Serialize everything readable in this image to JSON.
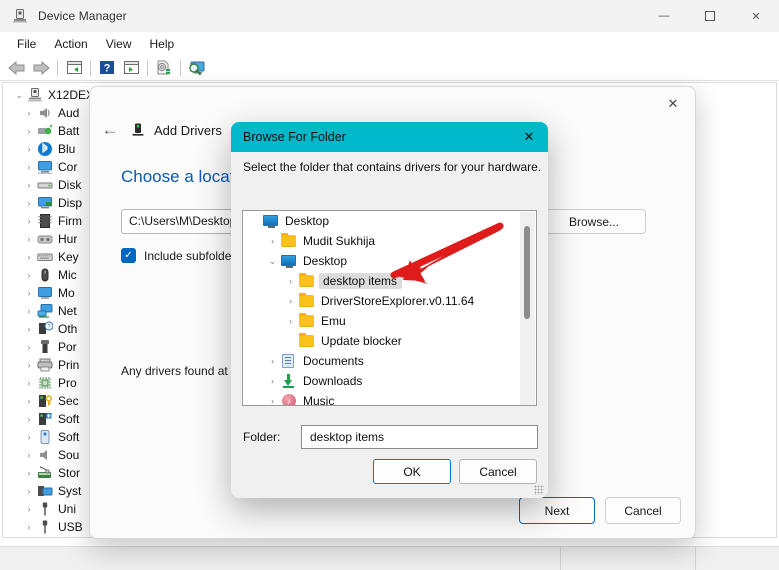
{
  "window": {
    "title": "Device Manager",
    "icon": "device-manager-icon",
    "controls": {
      "minimize": "—",
      "maximize": "☐",
      "close": "✕"
    }
  },
  "menubar": {
    "items": [
      "File",
      "Action",
      "View",
      "Help"
    ]
  },
  "toolbar": {
    "buttons": [
      "back-icon",
      "forward-icon",
      "show-hidden-devices-icon",
      "help-icon",
      "properties-icon",
      "update-driver-icon",
      "scan-hardware-icon"
    ]
  },
  "device_tree": {
    "root": {
      "label": "X12DEX",
      "expanded": true,
      "icon": "computer-icon"
    },
    "items": [
      {
        "label": "Aud",
        "icon": "audio-icon"
      },
      {
        "label": "Batt",
        "icon": "battery-icon"
      },
      {
        "label": "Blu",
        "icon": "bluetooth-icon"
      },
      {
        "label": "Cor",
        "icon": "computer-icon"
      },
      {
        "label": "Disk",
        "icon": "disk-drive-icon"
      },
      {
        "label": "Disp",
        "icon": "display-adapter-icon"
      },
      {
        "label": "Firm",
        "icon": "firmware-icon"
      },
      {
        "label": "Hur",
        "icon": "human-interface-icon"
      },
      {
        "label": "Key",
        "icon": "keyboard-icon"
      },
      {
        "label": "Mic",
        "icon": "mouse-icon"
      },
      {
        "label": "Mo",
        "icon": "monitor-icon"
      },
      {
        "label": "Net",
        "icon": "network-adapter-icon"
      },
      {
        "label": "Oth",
        "icon": "other-device-icon"
      },
      {
        "label": "Por",
        "icon": "ports-icon"
      },
      {
        "label": "Prin",
        "icon": "print-queue-icon"
      },
      {
        "label": "Pro",
        "icon": "processor-icon"
      },
      {
        "label": "Sec",
        "icon": "security-device-icon"
      },
      {
        "label": "Soft",
        "icon": "software-component-icon"
      },
      {
        "label": "Soft",
        "icon": "software-device-icon"
      },
      {
        "label": "Sou",
        "icon": "sound-controller-icon"
      },
      {
        "label": "Stor",
        "icon": "storage-controller-icon"
      },
      {
        "label": "Syst",
        "icon": "system-device-icon"
      },
      {
        "label": "Uni",
        "icon": "usb-icon"
      },
      {
        "label": "USB",
        "icon": "usb-icon"
      }
    ]
  },
  "wizard": {
    "close_label": "✕",
    "back_label": "←",
    "header_icon": "add-drivers-icon",
    "header_title": "Add Drivers",
    "heading": "Choose a location",
    "path_value": "C:\\Users\\M\\Desktop",
    "browse_label": "Browse...",
    "include_subfolders_label": "Include subfolders",
    "include_subfolders_checked": true,
    "check_glyph": "✓",
    "note": "Any drivers found at this location will be installed on all applicable devices.",
    "buttons": {
      "next": "Next",
      "cancel": "Cancel"
    }
  },
  "browse_dialog": {
    "title": "Browse For Folder",
    "close_label": "✕",
    "prompt": "Select the folder that contains drivers for your hardware.",
    "tree": [
      {
        "label": "Desktop",
        "icon": "desktop-icon",
        "indent": 0,
        "chevron": "",
        "selected": false
      },
      {
        "label": "Mudit Sukhija",
        "icon": "folder-icon",
        "indent": 1,
        "chevron": "›",
        "selected": false
      },
      {
        "label": "Desktop",
        "icon": "desktop-icon",
        "indent": 1,
        "chevron": "∨",
        "selected": false
      },
      {
        "label": "desktop items",
        "icon": "folder-icon",
        "indent": 2,
        "chevron": "›",
        "selected": true
      },
      {
        "label": "DriverStoreExplorer.v0.11.64",
        "icon": "folder-icon",
        "indent": 2,
        "chevron": "›",
        "selected": false
      },
      {
        "label": "Emu",
        "icon": "folder-icon",
        "indent": 2,
        "chevron": "›",
        "selected": false
      },
      {
        "label": "Update blocker",
        "icon": "folder-icon",
        "indent": 2,
        "chevron": "",
        "selected": false
      },
      {
        "label": "Documents",
        "icon": "documents-icon",
        "indent": 1,
        "chevron": "›",
        "selected": false
      },
      {
        "label": "Downloads",
        "icon": "downloads-icon",
        "indent": 1,
        "chevron": "›",
        "selected": false
      },
      {
        "label": "Music",
        "icon": "music-icon",
        "indent": 1,
        "chevron": "›",
        "selected": false
      }
    ],
    "folder_label": "Folder:",
    "folder_value": "desktop items",
    "buttons": {
      "ok": "OK",
      "cancel": "Cancel"
    }
  },
  "annotation": {
    "type": "red-arrow",
    "color": "#e01b1b",
    "points_to": "desktop items"
  },
  "colors": {
    "dialog_titlebar": "#00b8c9",
    "accent_blue": "#0067c0",
    "heading_blue": "#0a58b8",
    "annotation_red": "#e01b1b",
    "folder_yellow": "#fcc21b"
  }
}
